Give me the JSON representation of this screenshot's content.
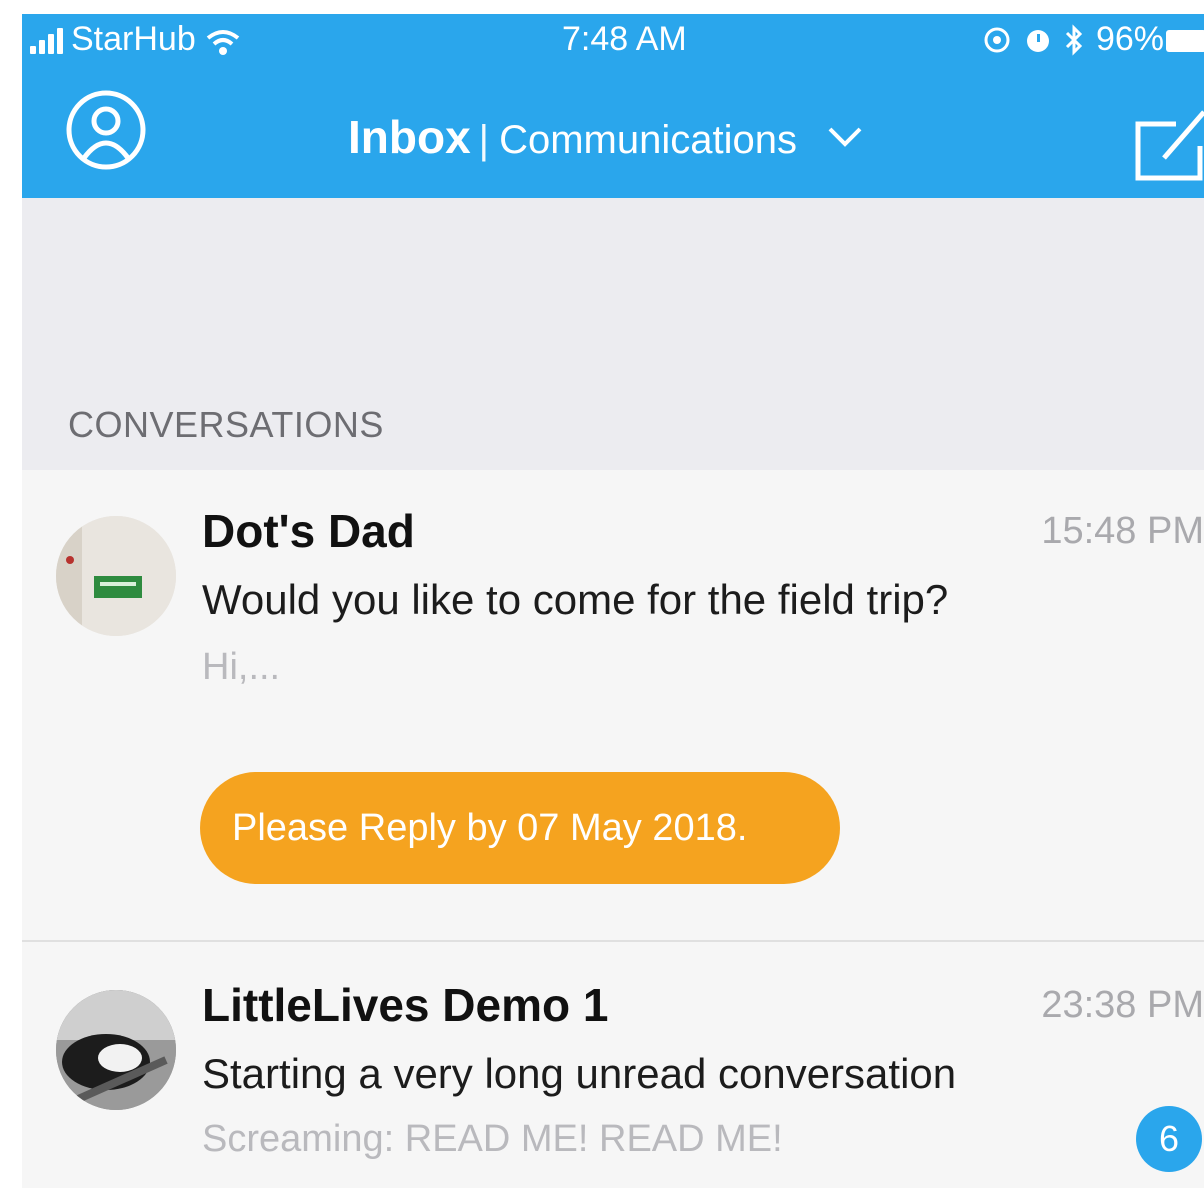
{
  "status_bar": {
    "carrier": "StarHub",
    "time": "7:48 AM",
    "battery": "96%"
  },
  "nav": {
    "title": "Inbox",
    "separator": "|",
    "subtitle": "Communications"
  },
  "section": {
    "label": "CONVERSATIONS"
  },
  "conversations": [
    {
      "sender": "Dot's Dad",
      "time": "15:48 PM",
      "subject": "Would you like to come for the field trip?",
      "preview": "Hi,...",
      "reply_notice": "Please Reply by 07 May 2018."
    },
    {
      "sender": "LittleLives Demo 1",
      "time": "23:38 PM",
      "subject": "Starting a very long unread conversation",
      "preview": "Screaming: READ ME! READ ME!",
      "unread_count": "6"
    }
  ],
  "colors": {
    "header": "#2aa6ec",
    "reply_pill": "#f5a31f",
    "badge": "#2aa6ec"
  }
}
